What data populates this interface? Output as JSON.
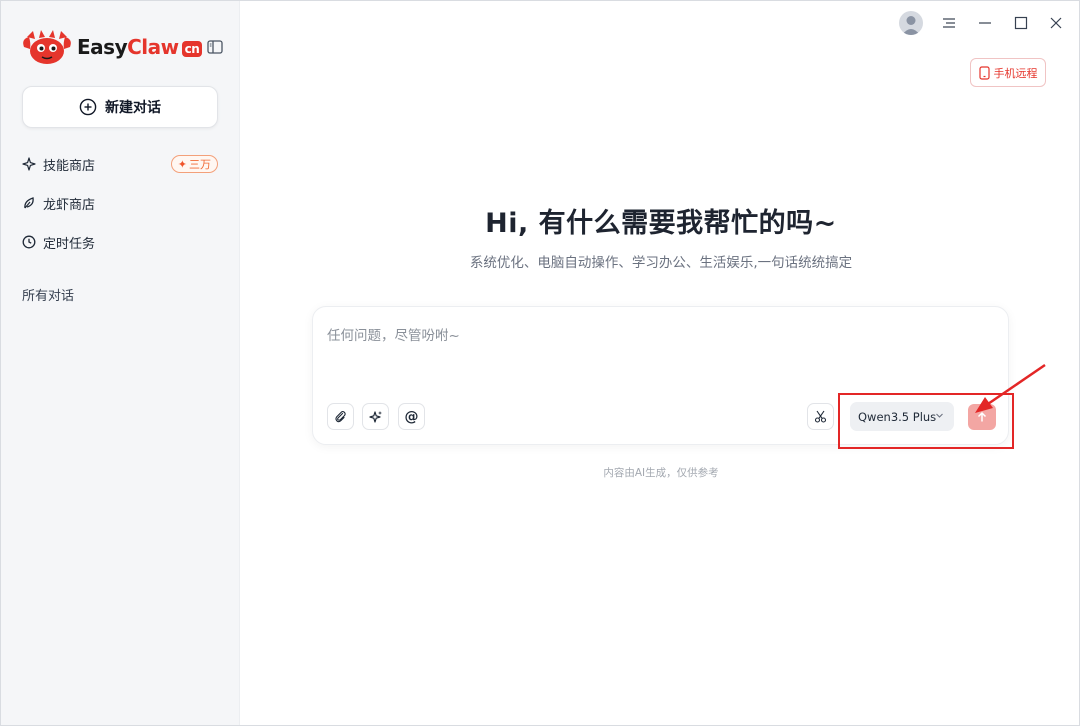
{
  "brand": {
    "name_part1": "Easy",
    "name_part2": "Claw",
    "badge": "cn",
    "accent_color": "#e5352c"
  },
  "sidebar": {
    "new_chat_label": "新建对话",
    "items": [
      {
        "label": "技能商店",
        "icon": "sparkle-icon",
        "badge": "三万"
      },
      {
        "label": "龙虾商店",
        "icon": "leaf-icon"
      },
      {
        "label": "定时任务",
        "icon": "clock-icon"
      }
    ],
    "section_label": "所有对话"
  },
  "header": {
    "remote_label": "手机远程"
  },
  "main": {
    "title": "Hi, 有什么需要我帮忙的吗~",
    "subtitle": "系统优化、电脑自动操作、学习办公、生活娱乐,一句话统统搞定",
    "input_placeholder": "任何问题，尽管吩咐~",
    "input_value": "",
    "tool_icons": [
      "attach-icon",
      "sparkle-icon",
      "at-icon"
    ],
    "scissor_icon": "scissors-icon",
    "model": "Qwen3.5 Plus",
    "disclaimer": "内容由AI生成，仅供参考"
  }
}
